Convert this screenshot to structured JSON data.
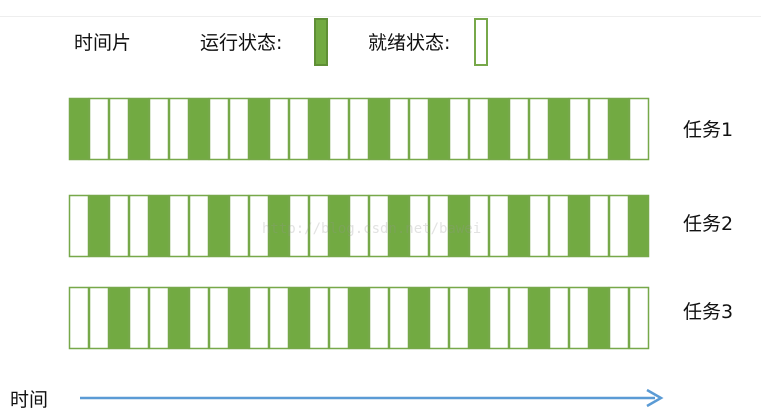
{
  "legend": {
    "time_slice": "时间片",
    "running": "运行状态:",
    "ready": "就绪状态:"
  },
  "colors": {
    "running_fill": "#72aa42",
    "ready_fill": "#ffffff",
    "outline": "#77a84a",
    "time_arrow": "#5b9bd5"
  },
  "tasks": [
    {
      "label": "任务1",
      "slots": 29,
      "running_slots": [
        0,
        3,
        6,
        9,
        12,
        15,
        18,
        21,
        24,
        27
      ]
    },
    {
      "label": "任务2",
      "slots": 29,
      "running_slots": [
        1,
        4,
        7,
        10,
        13,
        16,
        19,
        22,
        25,
        28
      ]
    },
    {
      "label": "任务3",
      "slots": 29,
      "running_slots": [
        2,
        5,
        8,
        11,
        14,
        17,
        20,
        23,
        26
      ]
    }
  ],
  "time_axis_label": "时间",
  "watermark": "http://blog.csdn.net/bawei"
}
